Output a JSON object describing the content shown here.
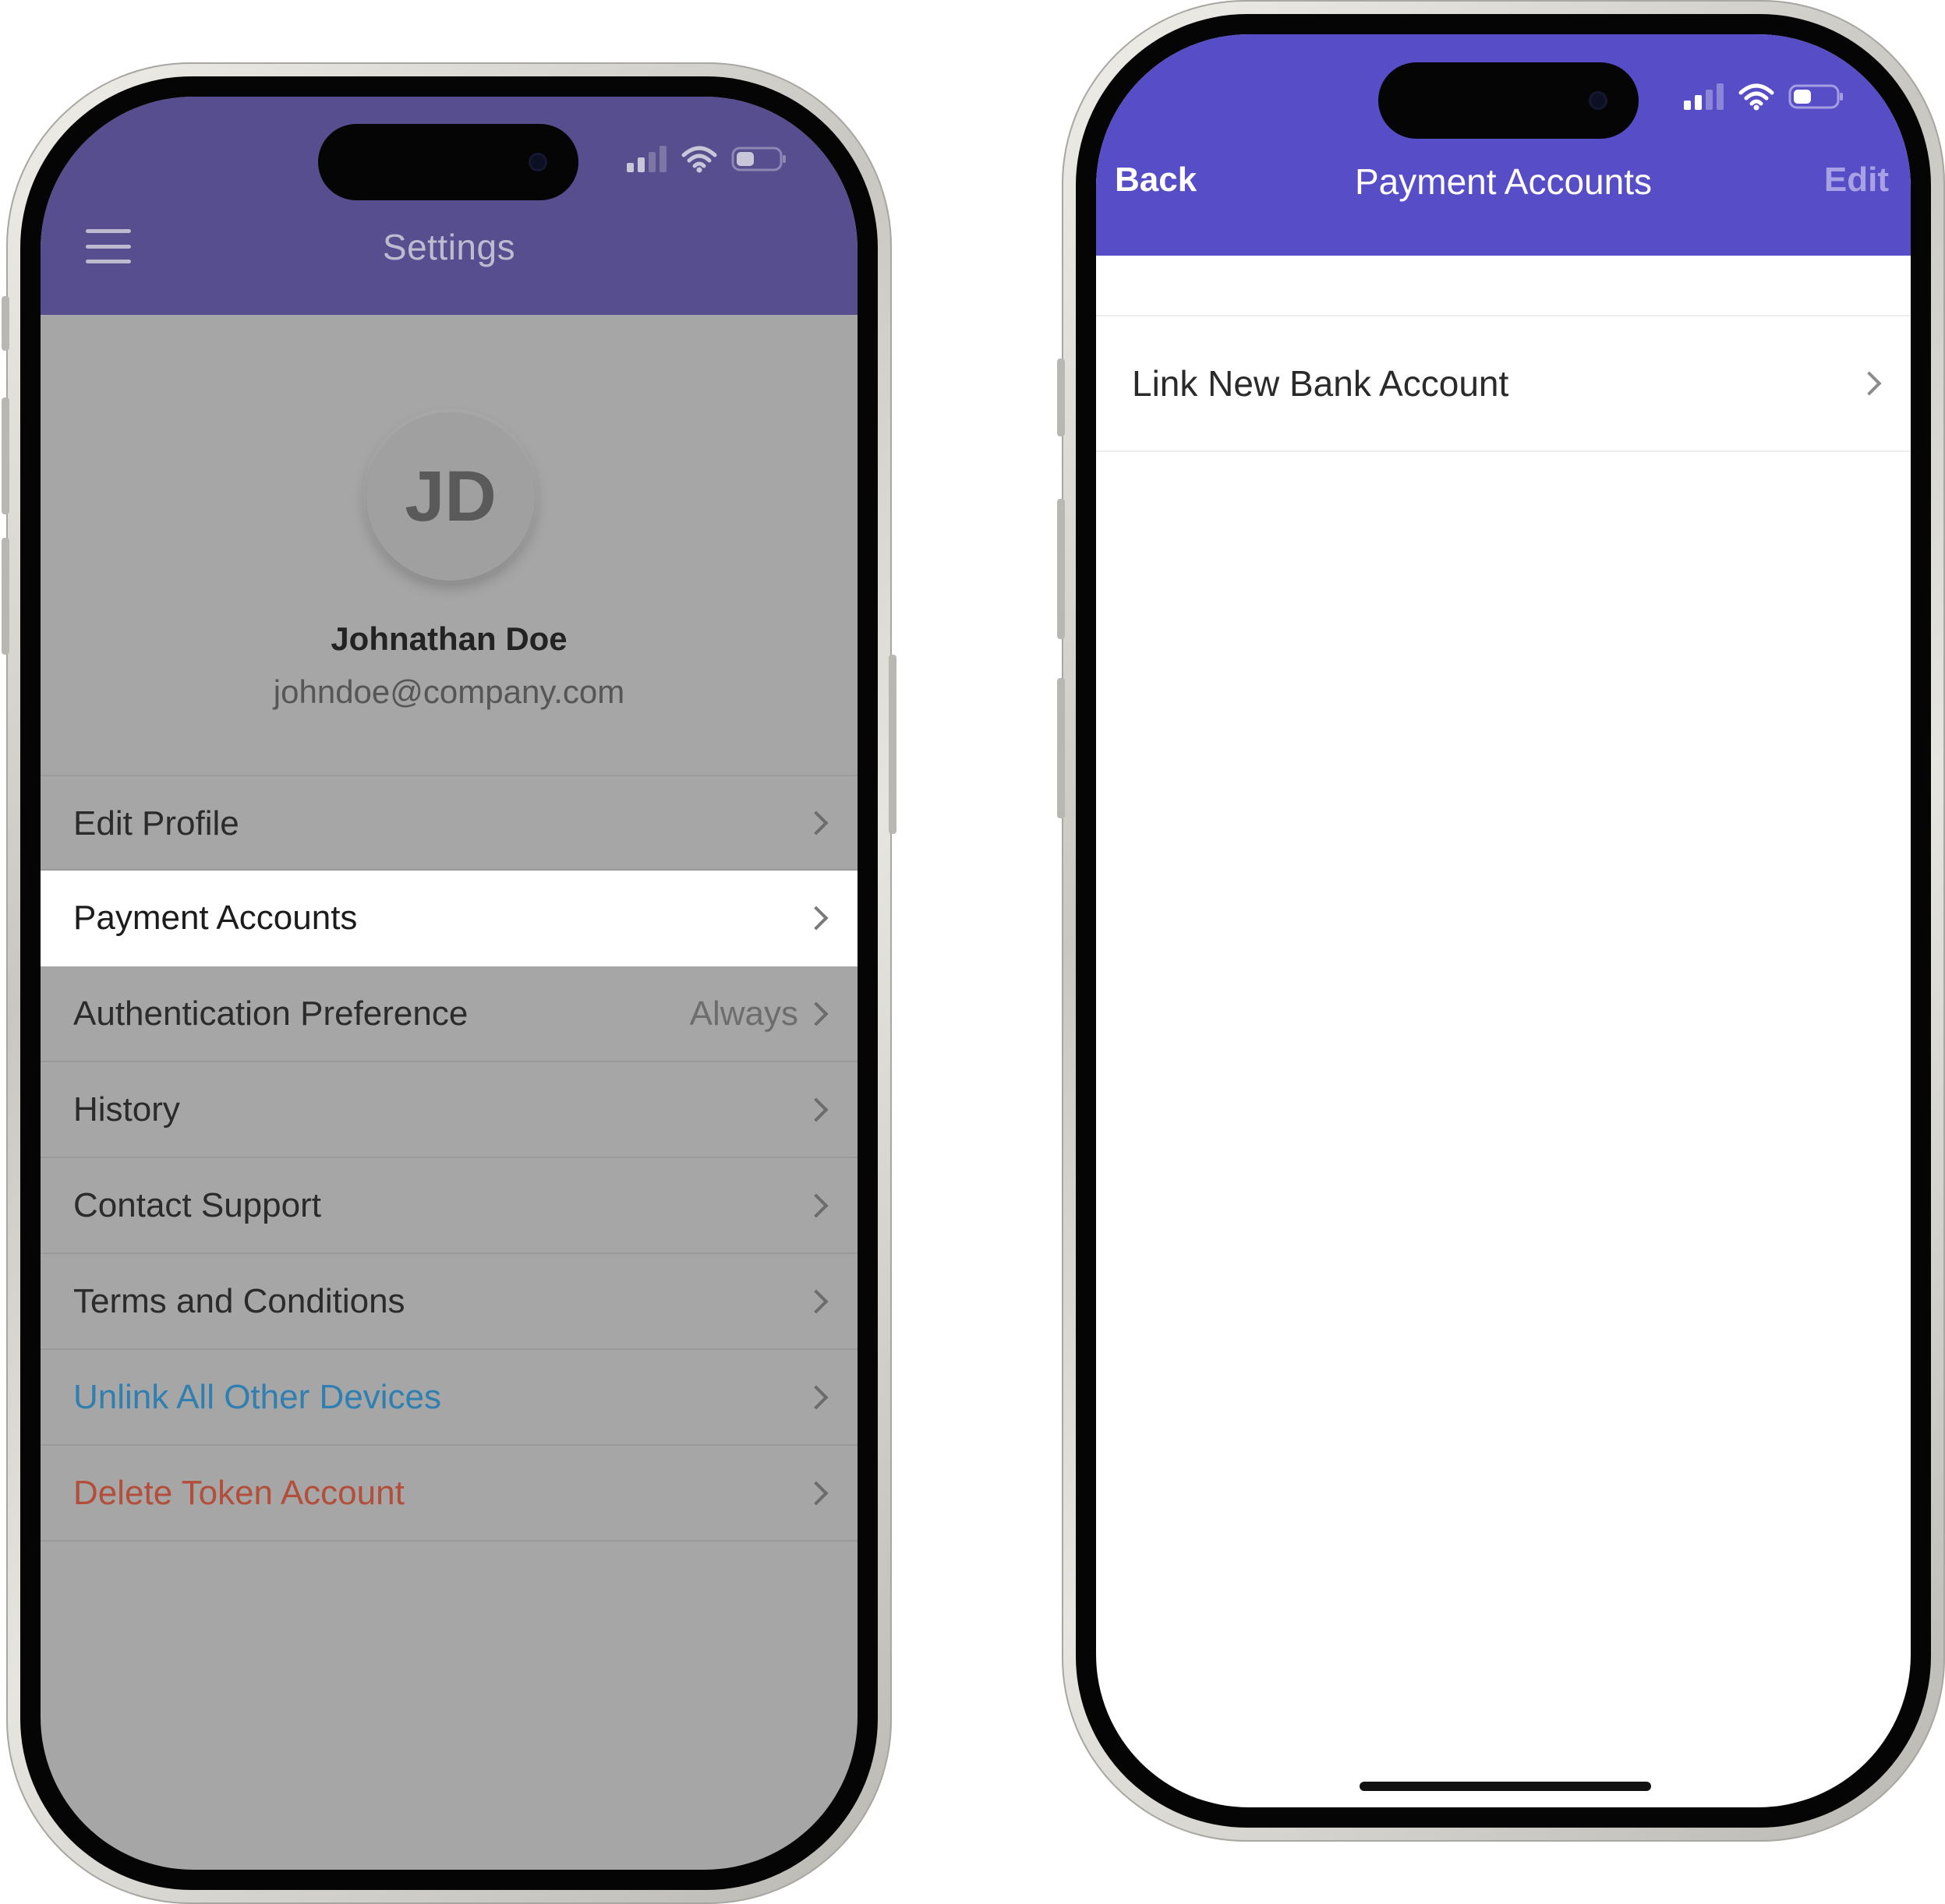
{
  "left_screen": {
    "app_bar": {
      "title": "Settings",
      "menu_icon": "hamburger-icon"
    },
    "status_bar": {
      "signal_icon": "cellular-signal-icon",
      "wifi_icon": "wifi-icon",
      "battery_icon": "battery-icon"
    },
    "profile": {
      "initials": "JD",
      "name": "Johnathan Doe",
      "email": "johndoe@company.com"
    },
    "menu_items": [
      {
        "label": "Edit Profile",
        "value": "",
        "color": "#2b2b2b"
      },
      {
        "label": "Payment Accounts",
        "value": "",
        "color": "#1c1c1c",
        "selected": true
      },
      {
        "label": "Authentication Preference",
        "value": "Always",
        "color": "#2b2b2b"
      },
      {
        "label": "History",
        "value": "",
        "color": "#2b2b2b"
      },
      {
        "label": "Contact Support",
        "value": "",
        "color": "#2b2b2b"
      },
      {
        "label": "Terms and Conditions",
        "value": "",
        "color": "#2b2b2b"
      },
      {
        "label": "Unlink All Other Devices",
        "value": "",
        "color": "#2f7fb1"
      },
      {
        "label": "Delete Token Account",
        "value": "",
        "color": "#b24e3a"
      }
    ],
    "colors": {
      "app_bar": "#574e8f",
      "dimmed_background": "#a6a6a6"
    }
  },
  "right_screen": {
    "nav_bar": {
      "back_label": "Back",
      "title": "Payment Accounts",
      "edit_label": "Edit"
    },
    "status_bar": {
      "signal_icon": "cellular-signal-icon",
      "wifi_icon": "wifi-icon",
      "battery_icon": "battery-icon"
    },
    "list_items": [
      {
        "label": "Link New Bank Account"
      }
    ],
    "colors": {
      "app_bar": "#574dc7",
      "edit_label": "#a8a2e4"
    }
  }
}
